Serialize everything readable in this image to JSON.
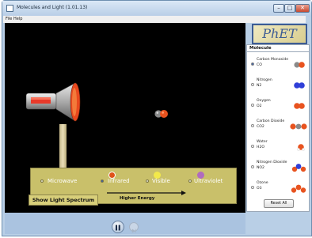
{
  "window": {
    "title": "Molecules and Light (1.01.13)",
    "min_glyph": "–",
    "max_glyph": "□",
    "close_glyph": "✕"
  },
  "menu": {
    "file": "File",
    "help": "Help"
  },
  "sim": {
    "background_color": "#000000",
    "panel_color": "#c9c06a",
    "selected_source": "Infrared",
    "light_sources": [
      {
        "label": "Microwave",
        "color": "#c9c06a",
        "selected": false
      },
      {
        "label": "Infrared",
        "color": "#e0531a",
        "selected": true
      },
      {
        "label": "Visible",
        "color": "#f2e94a",
        "selected": false
      },
      {
        "label": "Ultraviolet",
        "color": "#b06bbf",
        "selected": false
      }
    ],
    "energy_label": "Higher Energy",
    "spectrum_button": "Show Light Spectrum",
    "photon_source_icon": "lamp-icon"
  },
  "controls": {
    "play_pause_icon": "pause-icon",
    "step_icon": "step-forward-icon"
  },
  "logo": "PhET",
  "molecule_panel": {
    "header": "Molecule",
    "selected": "Carbon Monoxide",
    "items": [
      {
        "name": "Carbon Monoxide",
        "formula": "CO",
        "selected": true
      },
      {
        "name": "Nitrogen",
        "formula": "N2",
        "selected": false
      },
      {
        "name": "Oxygen",
        "formula": "O2",
        "selected": false
      },
      {
        "name": "Carbon Dioxide",
        "formula": "CO2",
        "selected": false
      },
      {
        "name": "Water",
        "formula": "H2O",
        "selected": false
      },
      {
        "name": "Nitrogen Dioxide",
        "formula": "NO2",
        "selected": false
      },
      {
        "name": "Ozone",
        "formula": "O3",
        "selected": false
      }
    ],
    "reset_label": "Reset All"
  }
}
